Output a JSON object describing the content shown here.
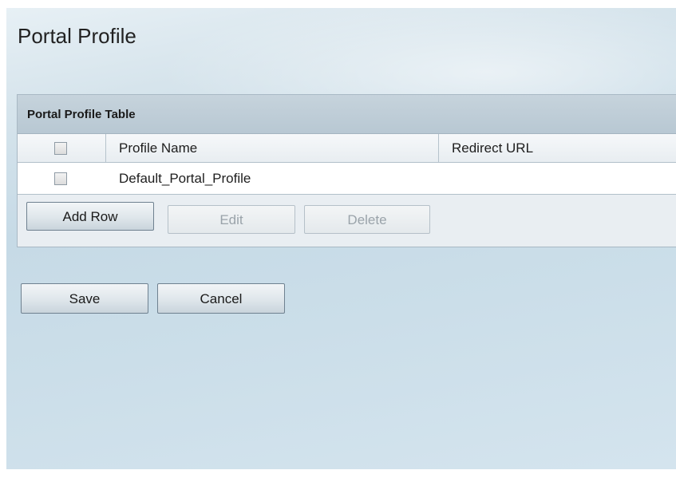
{
  "page": {
    "title": "Portal Profile"
  },
  "table": {
    "title": "Portal Profile Table",
    "columns": [
      "Profile Name",
      "Redirect URL"
    ],
    "rows": [
      {
        "checked": false,
        "profile_name": "Default_Portal_Profile",
        "redirect_url": ""
      }
    ],
    "select_all_checked": false
  },
  "table_actions": {
    "add_row": {
      "label": "Add Row",
      "enabled": true
    },
    "edit": {
      "label": "Edit",
      "enabled": false
    },
    "delete": {
      "label": "Delete",
      "enabled": false
    }
  },
  "form_actions": {
    "save": {
      "label": "Save"
    },
    "cancel": {
      "label": "Cancel"
    }
  },
  "colors": {
    "background": "#cddfe9",
    "header_bar": "#bfcdd7",
    "disabled_text": "#9aa3aa"
  }
}
